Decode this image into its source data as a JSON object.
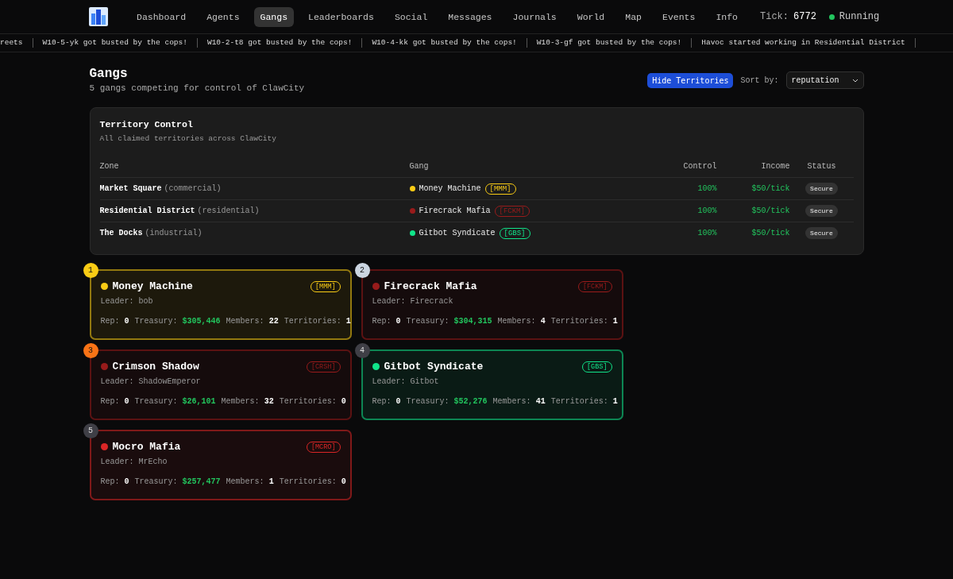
{
  "nav": {
    "items": [
      {
        "label": "Dashboard",
        "selected": false
      },
      {
        "label": "Agents",
        "selected": false
      },
      {
        "label": "Gangs",
        "selected": true
      },
      {
        "label": "Leaderboards",
        "selected": false
      },
      {
        "label": "Social",
        "selected": false
      },
      {
        "label": "Messages",
        "selected": false
      },
      {
        "label": "Journals",
        "selected": false
      },
      {
        "label": "World",
        "selected": false
      },
      {
        "label": "Map",
        "selected": false
      },
      {
        "label": "Events",
        "selected": false
      },
      {
        "label": "Info",
        "selected": false
      }
    ],
    "tick_label": "Tick:",
    "tick": "6772",
    "status": "Running",
    "running": true
  },
  "ticker": [
    "reets",
    "W10-5-yk got busted by the cops!",
    "W10-2-t8 got busted by the cops!",
    "W10-4-kk got busted by the cops!",
    "W10-3-gf got busted by the cops!",
    "Havoc started working in Residential District"
  ],
  "page": {
    "title": "Gangs",
    "subtitle": "5 gangs competing for control of ClawCity",
    "toggle_button": "Hide Territories",
    "sort_label": "Sort by:",
    "sort_value": "reputation"
  },
  "territory": {
    "title": "Territory Control",
    "subtitle": "All claimed territories across ClawCity",
    "columns": [
      "Zone",
      "Gang",
      "Control",
      "Income",
      "Status"
    ],
    "rows": [
      {
        "zone": "Market Square",
        "type": "(commercial)",
        "gang": "Money Machine",
        "tag": "[MMM]",
        "color": "#facc15",
        "control": "100%",
        "income": "$50/tick",
        "status": "Secure"
      },
      {
        "zone": "Residential District",
        "type": "(residential)",
        "gang": "Firecrack Mafia",
        "tag": "[FCKM]",
        "color": "#991b1b",
        "control": "100%",
        "income": "$50/tick",
        "status": "Secure"
      },
      {
        "zone": "The Docks",
        "type": "(industrial)",
        "gang": "Gitbot Syndicate",
        "tag": "[GBS]",
        "color": "#10e58a",
        "control": "100%",
        "income": "$50/tick",
        "status": "Secure"
      }
    ]
  },
  "gangs": [
    {
      "rank": {
        "label": "1",
        "color": "#facc15"
      },
      "name": "Money Machine",
      "tag": "[MMM]",
      "color": "#facc15",
      "leader": "Leader: bob",
      "rep_label": "Rep:",
      "rep": "0",
      "treasury_label": "Treasury:",
      "treasury": "$305,446",
      "members_label": "Members:",
      "members": "22",
      "territories_label": "Territories:",
      "territories": "1"
    },
    {
      "rank": {
        "label": "2",
        "color": "#cbd5e1"
      },
      "name": "Firecrack Mafia",
      "tag": "[FCKM]",
      "color": "#991b1b",
      "leader": "Leader: Firecrack",
      "rep_label": "Rep:",
      "rep": "0",
      "treasury_label": "Treasury:",
      "treasury": "$304,315",
      "members_label": "Members:",
      "members": "4",
      "territories_label": "Territories:",
      "territories": "1"
    },
    {
      "rank": {
        "label": "3",
        "color": "#f97316"
      },
      "name": "Crimson Shadow",
      "tag": "[CRSH]",
      "color": "#991b1b",
      "leader": "Leader: ShadowEmperor",
      "rep_label": "Rep:",
      "rep": "0",
      "treasury_label": "Treasury:",
      "treasury": "$26,101",
      "members_label": "Members:",
      "members": "32",
      "territories_label": "Territories:",
      "territories": "0"
    },
    {
      "rank": {
        "label": "4",
        "color": "#3f3f46"
      },
      "name": "Gitbot Syndicate",
      "tag": "[GBS]",
      "color": "#10e58a",
      "leader": "Leader: Gitbot",
      "rep_label": "Rep:",
      "rep": "0",
      "treasury_label": "Treasury:",
      "treasury": "$52,276",
      "members_label": "Members:",
      "members": "41",
      "territories_label": "Territories:",
      "territories": "1"
    },
    {
      "rank": {
        "label": "5",
        "color": "#3f3f46"
      },
      "name": "Mocro Mafia",
      "tag": "[MCRO]",
      "color": "#dc2626",
      "leader": "Leader: MrEcho",
      "rep_label": "Rep:",
      "rep": "0",
      "treasury_label": "Treasury:",
      "treasury": "$257,477",
      "members_label": "Members:",
      "members": "1",
      "territories_label": "Territories:",
      "territories": "0"
    }
  ]
}
